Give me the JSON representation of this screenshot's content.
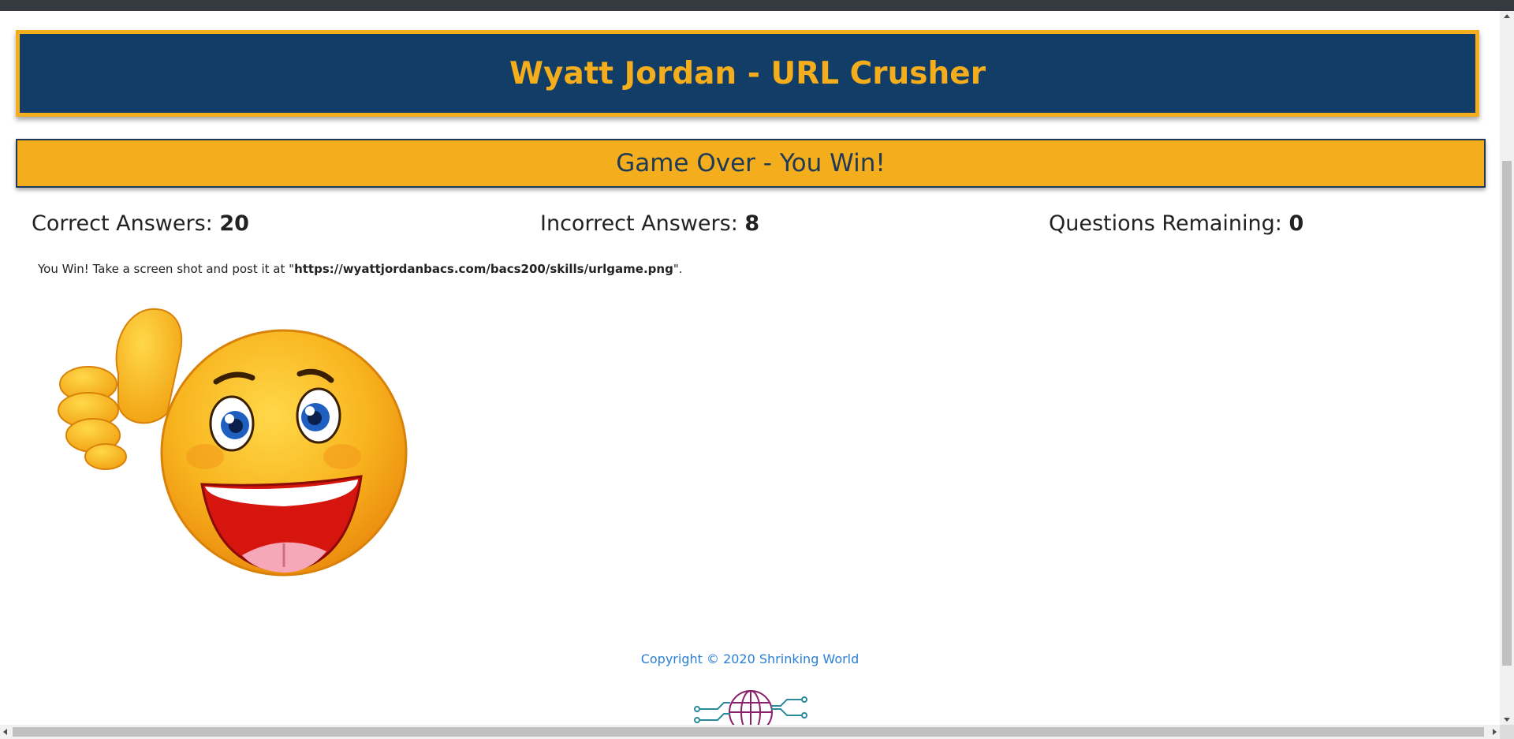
{
  "header": {
    "title": "Wyatt Jordan - URL Crusher"
  },
  "status": {
    "text": "Game Over - You Win!"
  },
  "stats": {
    "correct_label": "Correct Answers:",
    "correct_value": "20",
    "incorrect_label": "Incorrect Answers:",
    "incorrect_value": "8",
    "remaining_label": "Questions Remaining:",
    "remaining_value": "0"
  },
  "message": {
    "prefix": "You Win! Take a screen shot and post it at \"",
    "url": "https://wyattjordanbacs.com/bacs200/skills/urlgame.png",
    "suffix": "\"."
  },
  "image": {
    "icon": "thumbs-up-smiley-icon"
  },
  "footer": {
    "copyright": "Copyright © 2020 Shrinking World",
    "logo_icon": "globe-circuit-logo-icon"
  },
  "colors": {
    "navy": "#123d66",
    "gold": "#f4ad1c",
    "link_blue": "#2a7fd6"
  }
}
